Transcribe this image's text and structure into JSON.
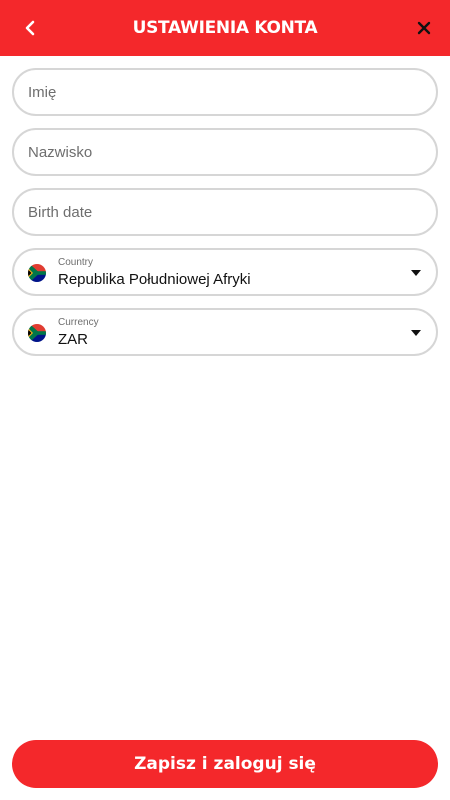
{
  "header": {
    "title": "USTAWIENIA KONTA",
    "back_icon": "chevron-left-icon",
    "close_icon": "close-icon",
    "background_color": "#f4282b"
  },
  "form": {
    "first_name": {
      "placeholder": "Imię",
      "value": ""
    },
    "last_name": {
      "placeholder": "Nazwisko",
      "value": ""
    },
    "birth_date": {
      "placeholder": "Birth date",
      "value": ""
    },
    "country": {
      "label": "Country",
      "value": "Republika Południowej Afryki",
      "flag_icon": "south-africa-flag-icon"
    },
    "currency": {
      "label": "Currency",
      "value": "ZAR",
      "flag_icon": "south-africa-flag-icon"
    }
  },
  "submit": {
    "label": "Zapisz i zaloguj się",
    "background_color": "#f4282b"
  }
}
